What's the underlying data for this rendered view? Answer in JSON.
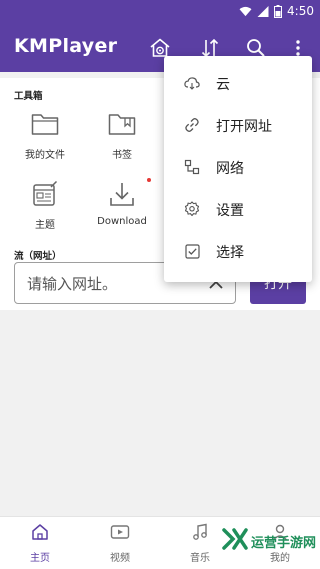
{
  "status_bar": {
    "time": "4:50"
  },
  "app_bar": {
    "title": "KMPlayer",
    "icons": [
      "home-settings-icon",
      "sort-icon",
      "search-icon",
      "more-vert-icon"
    ]
  },
  "tools": {
    "section_title": "工具箱",
    "items": [
      {
        "label": "我的文件",
        "icon": "folder-icon"
      },
      {
        "label": "书签",
        "icon": "bookmark-folder-icon"
      },
      {
        "label": "主题",
        "icon": "theme-icon"
      },
      {
        "label": "Download",
        "icon": "download-icon"
      }
    ]
  },
  "stream": {
    "section_title": "流（网址）",
    "url_placeholder": "请输入网址。",
    "open_button": "打开"
  },
  "popup_menu": {
    "items": [
      {
        "label": "云",
        "icon": "cloud-icon"
      },
      {
        "label": "打开网址",
        "icon": "link-icon"
      },
      {
        "label": "网络",
        "icon": "network-icon"
      },
      {
        "label": "设置",
        "icon": "settings-icon"
      },
      {
        "label": "选择",
        "icon": "checkbox-icon"
      }
    ]
  },
  "bottom_nav": {
    "items": [
      {
        "label": "主页",
        "icon": "home-icon",
        "active": true
      },
      {
        "label": "视频",
        "icon": "video-icon",
        "active": false
      },
      {
        "label": "音乐",
        "icon": "music-icon",
        "active": false
      },
      {
        "label": "我的",
        "icon": "profile-icon",
        "active": false
      }
    ]
  },
  "watermark": {
    "text": "运营手游网"
  },
  "colors": {
    "primary": "#5b3fa3",
    "background": "#f1f1f1",
    "surface": "#ffffff",
    "accent_dot": "#e53935",
    "watermark": "#1f8f5a"
  }
}
